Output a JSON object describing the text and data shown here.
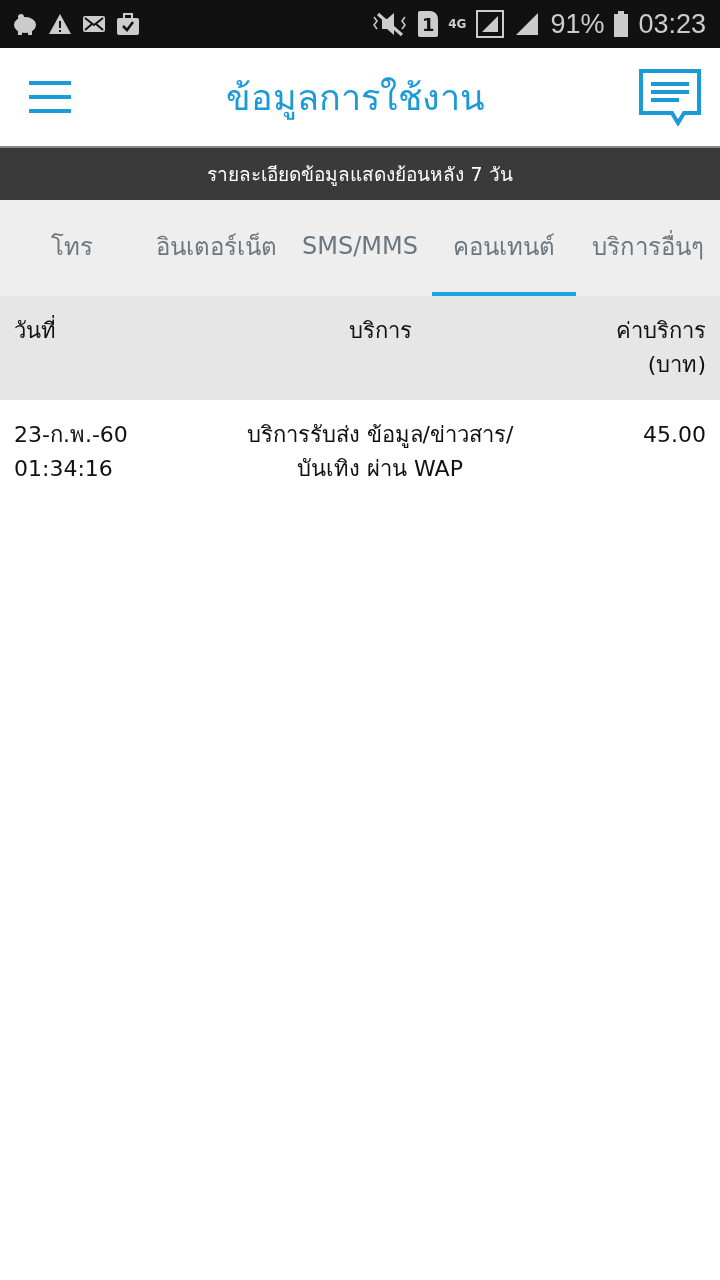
{
  "status_bar": {
    "sim_slot": "1",
    "network": "4G",
    "battery": "91%",
    "time": "03:23"
  },
  "header": {
    "title": "ข้อมูลการใช้งาน"
  },
  "notice": "รายละเอียดข้อมูลแสดงย้อนหลัง 7 วัน",
  "tabs": [
    {
      "label": "โทร",
      "selected": false
    },
    {
      "label": "อินเตอร์เน็ต",
      "selected": false
    },
    {
      "label": "SMS/MMS",
      "selected": false
    },
    {
      "label": "คอนเทนต์",
      "selected": true
    },
    {
      "label": "บริการอื่นๆ",
      "selected": false
    }
  ],
  "table": {
    "columns": [
      [
        "วันที่"
      ],
      [
        "บริการ"
      ],
      [
        "ค่าบริการ",
        "(บาท)"
      ]
    ],
    "rows": [
      {
        "date": [
          "23-ก.พ.-60",
          "01:34:16"
        ],
        "service": [
          "บริการรับส่ง ข้อมูล/ข่าวสาร/",
          "บันเทิง ผ่าน WAP"
        ],
        "charge": "45.00"
      }
    ]
  }
}
